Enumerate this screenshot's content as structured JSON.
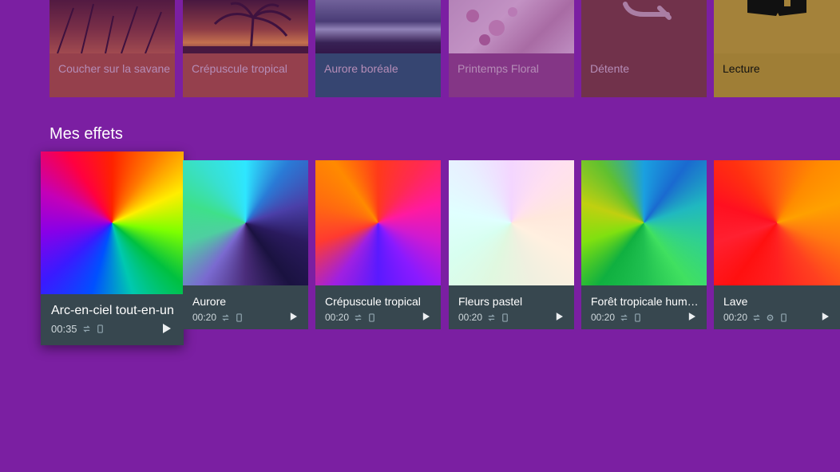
{
  "scenes": [
    {
      "label": "Coucher sur la savane"
    },
    {
      "label": "Crépuscule tropical"
    },
    {
      "label": "Aurore boréale"
    },
    {
      "label": "Printemps Floral"
    },
    {
      "label": "Détente",
      "icon": "wand-icon"
    },
    {
      "label": "Lecture",
      "icon": "book-icon"
    }
  ],
  "section": {
    "title": "Mes effets"
  },
  "effects": [
    {
      "name": "Arc-en-ciel tout-en-un",
      "duration": "00:35",
      "icons": [
        "repeat-icon",
        "phone-icon",
        "play-icon"
      ]
    },
    {
      "name": "Aurore",
      "duration": "00:20",
      "icons": [
        "repeat-icon",
        "phone-icon",
        "play-icon"
      ]
    },
    {
      "name": "Crépuscule tropical",
      "duration": "00:20",
      "icons": [
        "repeat-icon",
        "phone-icon",
        "play-icon"
      ]
    },
    {
      "name": "Fleurs pastel",
      "duration": "00:20",
      "icons": [
        "repeat-icon",
        "phone-icon",
        "play-icon"
      ]
    },
    {
      "name": "Forêt tropicale humide",
      "duration": "00:20",
      "icons": [
        "repeat-icon",
        "phone-icon",
        "play-icon"
      ]
    },
    {
      "name": "Lave",
      "duration": "00:20",
      "icons": [
        "repeat-icon",
        "gear-icon",
        "phone-icon",
        "play-icon"
      ]
    }
  ],
  "colors": {
    "background": "#7b1fa2",
    "card_info": "#37474f"
  }
}
